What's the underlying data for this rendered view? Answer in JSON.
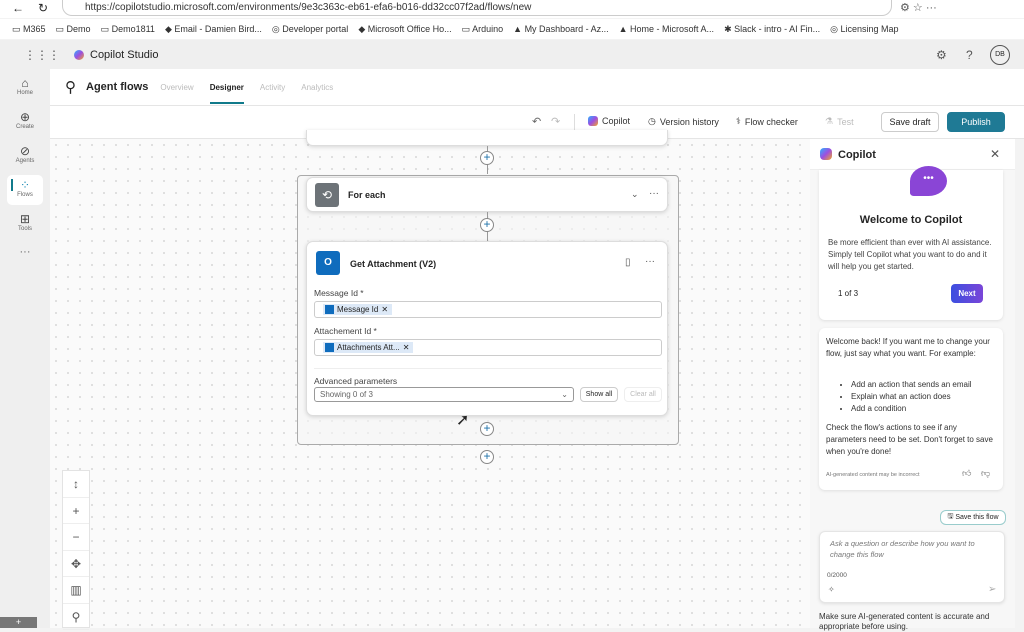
{
  "browser": {
    "url": "https://copilotstudio.microsoft.com/environments/9e3c363c-eb61-efa6-b016-dd32cc07f2ad/flows/new",
    "bookmarks": [
      "M365",
      "Demo",
      "Demo1811",
      "Email - Damien Bird...",
      "Developer portal",
      "Microsoft Office Ho...",
      "Arduino",
      "My Dashboard - Az...",
      "Home - Microsoft A...",
      "Slack - intro - AI Fin...",
      "Licensing Map"
    ]
  },
  "app": {
    "title": "Copilot Studio",
    "avatar": "DB"
  },
  "rail": [
    {
      "label": "Home",
      "icon": "⌂"
    },
    {
      "label": "Create",
      "icon": "⊕"
    },
    {
      "label": "Agents",
      "icon": "⊘"
    },
    {
      "label": "Flows",
      "icon": "⁘"
    },
    {
      "label": "Tools",
      "icon": "⊞"
    }
  ],
  "rail_more": "···",
  "page": {
    "title": "Agent flows",
    "tabs": [
      "Overview",
      "Designer",
      "Activity",
      "Analytics"
    ]
  },
  "toolbar": {
    "copilot": "Copilot",
    "version_history": "Version history",
    "flow_checker": "Flow checker",
    "test": "Test",
    "save_draft": "Save draft",
    "publish": "Publish"
  },
  "flow": {
    "foreach": {
      "title": "For each"
    },
    "action": {
      "title": "Get Attachment (V2)",
      "fields": [
        {
          "label": "Message Id *",
          "token": "Message Id"
        },
        {
          "label": "Attachement Id *",
          "token": "Attachments Att..."
        }
      ],
      "advanced_label": "Advanced parameters",
      "advanced_value": "Showing 0 of 3",
      "show_all": "Show all",
      "clear_all": "Clear all"
    }
  },
  "copilot": {
    "title": "Copilot",
    "welcome_title": "Welcome to Copilot",
    "welcome_text": "Be more efficient than ever with AI assistance. Simply tell Copilot what you want to do and it will help you get started.",
    "pager": "1 of 3",
    "next": "Next",
    "msg_intro": "Welcome back! If you want me to change your flow, just say what you want. For example:",
    "msg_bullets": [
      "Add an action that sends an email",
      "Explain what an action does",
      "Add a condition"
    ],
    "msg_outro": "Check the flow's actions to see if any parameters need to be set. Don't forget to save when you're done!",
    "disclaimer": "AI-generated content may be incorrect",
    "save_flow": "Save this flow",
    "input_placeholder": "Ask a question or describe how you want to change this flow",
    "counter": "0/2000",
    "footer": "Make sure AI-generated content is accurate and appropriate before using."
  },
  "colors": {
    "accent": "#117a8b",
    "publish": "#1f7a95",
    "next": "#3b4fe0"
  }
}
